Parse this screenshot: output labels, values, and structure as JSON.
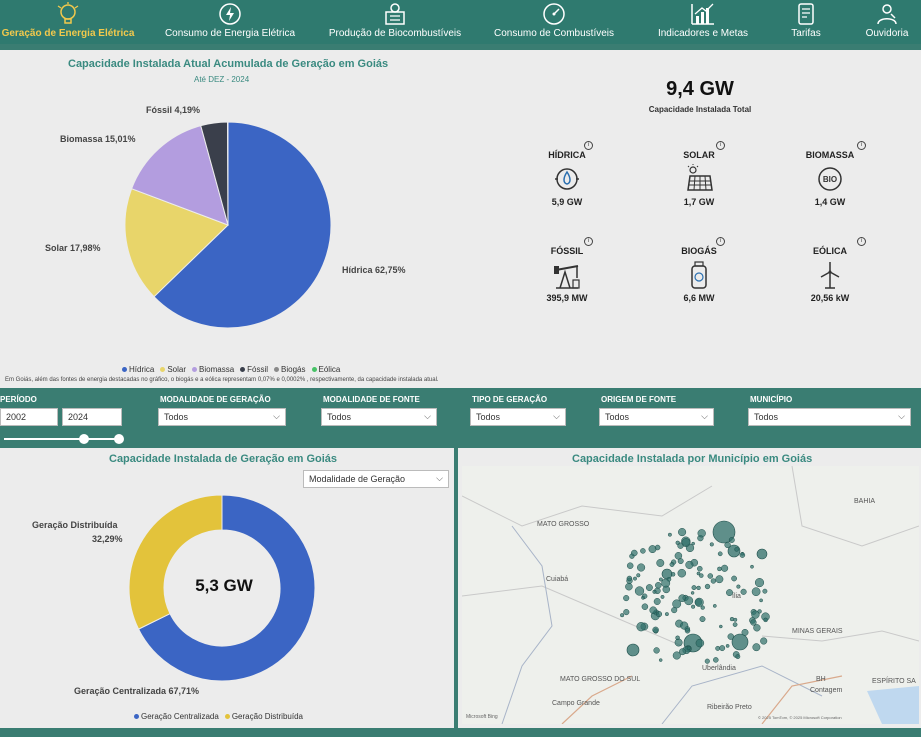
{
  "nav": {
    "items": [
      {
        "label": "Geração de Energia Elétrica",
        "icon": "lightbulb-icon",
        "active": true
      },
      {
        "label": "Consumo de Energia Elétrica",
        "icon": "power-icon"
      },
      {
        "label": "Produção de Biocombustíveis",
        "icon": "biofuel-icon"
      },
      {
        "label": "Consumo de Combustíveis",
        "icon": "gauge-icon"
      },
      {
        "label": "Indicadores e Metas",
        "icon": "chart-icon"
      },
      {
        "label": "Tarifas",
        "icon": "invoice-icon"
      },
      {
        "label": "Ouvidoria",
        "icon": "ombudsman-icon"
      }
    ]
  },
  "top_panel": {
    "title": "Capacidade Instalada Atual Acumulada de Geração em Goiás",
    "subtitle": "Até DEZ - 2024",
    "pie_labels": {
      "hidrica": "Hídrica 62,75%",
      "solar": "Solar 17,98%",
      "biomassa": "Biomassa 15,01%",
      "fossil": "Fóssil 4,19%"
    },
    "legend": [
      "Hídrica",
      "Solar",
      "Biomassa",
      "Fóssil",
      "Biogás",
      "Eólica"
    ],
    "footnote": "Em Goiás, além das fontes de energia destacadas no gráfico, o biogás e a eólica representam 0,07% e 0,0002% , respectivamente, da capacidade instalada atual.",
    "total_value": "9,4 GW",
    "total_label": "Capacidade Instalada Total",
    "kpis": [
      {
        "label": "HÍDRICA",
        "value": "5,9 GW",
        "icon": "hydro-icon"
      },
      {
        "label": "SOLAR",
        "value": "1,7 GW",
        "icon": "solar-panel-icon"
      },
      {
        "label": "BIOMASSA",
        "value": "1,4 GW",
        "icon": "biomass-icon"
      },
      {
        "label": "FÓSSIL",
        "value": "395,9 MW",
        "icon": "oil-pump-icon"
      },
      {
        "label": "BIOGÁS",
        "value": "6,6 MW",
        "icon": "biogas-icon"
      },
      {
        "label": "EÓLICA",
        "value": "20,56 kW",
        "icon": "wind-turbine-icon"
      }
    ]
  },
  "filters": {
    "periodo_label": "PERÍODO",
    "year_from": "2002",
    "year_to": "2024",
    "modalidade_geracao_label": "MODALIDADE DE GERAÇÃO",
    "modalidade_fonte_label": "MODALIDADE DE FONTE",
    "tipo_geracao_label": "TIPO DE GERAÇÃO",
    "origem_fonte_label": "ORIGEM DE FONTE",
    "municipio_label": "MUNICÍPIO",
    "todos": "Todos"
  },
  "bottom_left": {
    "title": "Capacidade Instalada de Geração em Goiás",
    "dropdown": "Modalidade de Geração",
    "center_value": "5,3 GW",
    "label_distribuida": "Geração Distribuída",
    "value_distribuida": "32,29%",
    "label_centralizada": "Geração Centralizada 67,71%",
    "legend": [
      "Geração Centralizada",
      "Geração Distribuída"
    ]
  },
  "map": {
    "title": "Capacidade Instalada por Município em Goiás",
    "labels": {
      "bahia": "BAHIA",
      "mato_grosso": "MATO GROSSO",
      "cuiaba": "Cuiabá",
      "minas_gerais": "MINAS GERAIS",
      "uberlandia": "Uberlândia",
      "mato_grosso_do_sul": "MATO GROSSO DO SUL",
      "bh": "BH",
      "contagem": "Contagem",
      "espirito_santo": "ESPÍRITO SA",
      "campo_grande": "Campo Grande",
      "ribeirao_preto": "Ribeirão Preto",
      "brasilia": "ília"
    },
    "copyright": "© 2025 TomTom, © 2025 Microsoft Corporation",
    "attribution": "Microsoft Bing"
  },
  "chart_data": [
    {
      "type": "pie",
      "title": "Capacidade Instalada Atual Acumulada de Geração em Goiás",
      "subtitle": "Até DEZ - 2024",
      "categories": [
        "Hídrica",
        "Solar",
        "Biomassa",
        "Fóssil",
        "Biogás",
        "Eólica"
      ],
      "values": [
        62.75,
        17.98,
        15.01,
        4.19,
        0.07,
        0.0002
      ],
      "colors": [
        "#3b65c4",
        "#e8d56a",
        "#b39ddf",
        "#3a3f4b",
        "#8a8a8a",
        "#47c266"
      ],
      "legend": "bottom"
    },
    {
      "type": "pie",
      "title": "Capacidade Instalada de Geração em Goiás",
      "categories": [
        "Geração Centralizada",
        "Geração Distribuída"
      ],
      "values": [
        67.71,
        32.29
      ],
      "colors": [
        "#3b65c4",
        "#e3c33b"
      ],
      "donut": true,
      "legend": "bottom"
    }
  ]
}
